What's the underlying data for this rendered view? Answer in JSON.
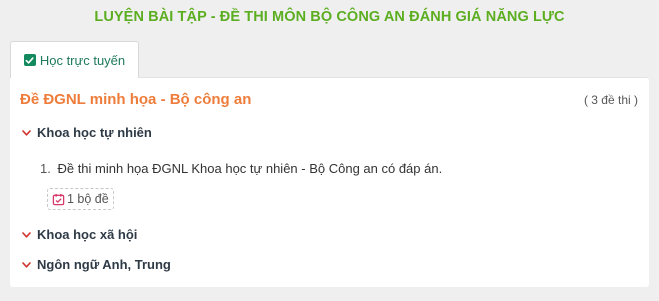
{
  "page": {
    "title": "LUYỆN BÀI TẬP - ĐỀ THI MÔN BỘ CÔNG AN ĐÁNH GIÁ NĂNG LỰC"
  },
  "tabs": [
    {
      "label": "Học trực tuyến",
      "icon": "checkbox-icon",
      "active": true
    }
  ],
  "section": {
    "title": "Đề ĐGNL minh họa - Bộ công an",
    "count_label": "( 3 đề thi )",
    "categories": [
      {
        "label": "Khoa học tự nhiên",
        "icon": "chevron-down-icon",
        "items": [
          {
            "number": "1.",
            "text": "Đề thi minh họa ĐGNL Khoa học tự nhiên - Bộ Công an có đáp án.",
            "badge": {
              "icon": "calendar-check-icon",
              "label": "1 bộ đề"
            }
          }
        ]
      },
      {
        "label": "Khoa học xã hội",
        "icon": "chevron-down-icon"
      },
      {
        "label": "Ngôn ngữ Anh, Trung",
        "icon": "chevron-down-icon"
      }
    ]
  },
  "colors": {
    "title_green": "#5cae21",
    "section_orange": "#ee7d3b",
    "chevron_red": "#d0312d",
    "tab_green": "#138a5e",
    "badge_icon_pink": "#d63a6a"
  }
}
